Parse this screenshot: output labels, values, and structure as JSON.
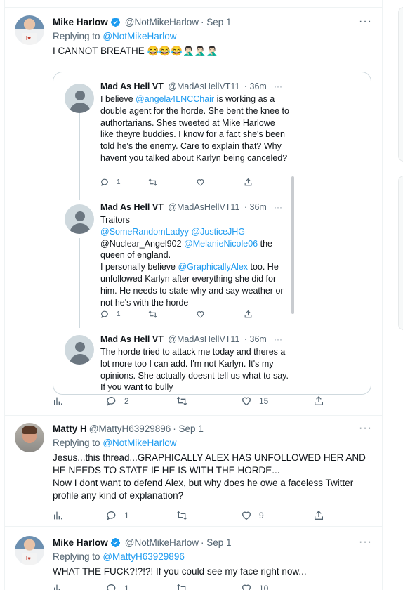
{
  "tweets": [
    {
      "name": "Mike Harlow",
      "handle": "@NotMikeHarlow",
      "time": "· Sep 1",
      "replying_label": "Replying to",
      "replying_to": "@NotMikeHarlow",
      "text": "I CANNOT BREATHE 😂😂😂🤦🏻‍♂️🤦🏻‍♂️🤦🏻‍♂️",
      "counts": {
        "reply": "2",
        "retweet": "",
        "like": "15"
      }
    },
    {
      "name": "Matty H",
      "handle": "@MattyH63929896",
      "time": "· Sep 1",
      "replying_label": "Replying to",
      "replying_to": "@NotMikeHarlow",
      "text1": "Jesus...this thread...GRAPHICALLY ALEX HAS UNFOLLOWED HER AND HE NEEDS TO STATE IF HE IS WITH THE HORDE...",
      "text2": "Now I dont want to defend Alex, but why does he owe a faceless Twitter profile any kind of explanation?",
      "counts": {
        "reply": "1",
        "retweet": "",
        "like": "9"
      }
    },
    {
      "name": "Mike Harlow",
      "handle": "@NotMikeHarlow",
      "time": "· Sep 1",
      "replying_label": "Replying to",
      "replying_to": "@MattyH63929896",
      "text": "WHAT THE FUCK?!?!?! If you could see my face right now...",
      "counts": {
        "reply": "1",
        "retweet": "",
        "like": "10"
      }
    }
  ],
  "quoted": [
    {
      "name": "Mad As Hell VT",
      "handle": "@MadAsHellVT11",
      "time": "· 36m",
      "pre": "I believe ",
      "mention": "@angela4LNCChair",
      "post": " is working as a double agent for the horde. She bent the knee to authortarians. Shes tweeted at Mike Harlowe like theyre buddies. I know for a fact she's been told he's the enemy. Care to explain that? Why havent you talked about Karlyn being canceled?",
      "reply_count": "1"
    },
    {
      "name": "Mad As Hell VT",
      "handle": "@MadAsHellVT11",
      "time": "· 36m",
      "line1": "Traitors",
      "m1": "@SomeRandomLadyy",
      "m2": "@JusticeJHG",
      "plain1": "@Nuclear_Angel902",
      "m3": "@MelanieNicole06",
      "line3": " the queen of england.",
      "line4_pre": "I personally believe ",
      "m4": "@GraphicallyAlex",
      "line4_post": " too. He unfollowed Karlyn after everything she did for him. He needs to state why and say weather or not he's with the horde",
      "reply_count": "1"
    },
    {
      "name": "Mad As Hell VT",
      "handle": "@MadAsHellVT11",
      "time": "· 36m",
      "text": "The horde tried to attack me today and theres a lot more too I can add. I'm not Karlyn. It's my opinions. She actually doesnt tell us what to say. If you want to bully"
    }
  ],
  "more_glyph": "···",
  "colors": {
    "link": "#1d9bf0",
    "muted": "#536471",
    "verified": "#1d9bf0"
  },
  "icons": [
    "verified-icon",
    "more-icon",
    "reply-icon",
    "retweet-icon",
    "like-icon",
    "share-icon",
    "analytics-icon"
  ]
}
